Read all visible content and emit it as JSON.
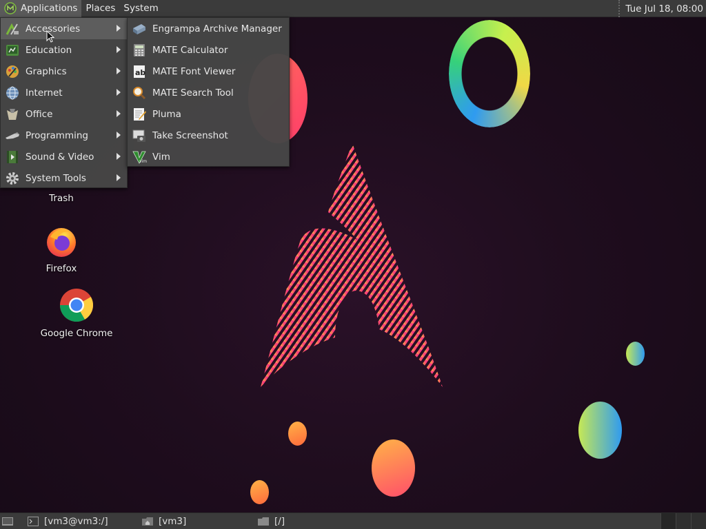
{
  "top_panel": {
    "menus": [
      "Applications",
      "Places",
      "System"
    ],
    "clock": "Tue Jul 18, 08:00"
  },
  "app_menu": {
    "items": [
      {
        "label": "Accessories",
        "icon": "accessories-icon"
      },
      {
        "label": "Education",
        "icon": "education-icon"
      },
      {
        "label": "Graphics",
        "icon": "graphics-icon"
      },
      {
        "label": "Internet",
        "icon": "internet-icon"
      },
      {
        "label": "Office",
        "icon": "office-icon"
      },
      {
        "label": "Programming",
        "icon": "programming-icon"
      },
      {
        "label": "Sound & Video",
        "icon": "sound-video-icon"
      },
      {
        "label": "System Tools",
        "icon": "system-tools-icon"
      }
    ]
  },
  "accessories_menu": {
    "items": [
      {
        "label": "Engrampa Archive Manager",
        "icon": "archive-manager-icon"
      },
      {
        "label": "MATE Calculator",
        "icon": "calculator-icon"
      },
      {
        "label": "MATE Font Viewer",
        "icon": "font-viewer-icon"
      },
      {
        "label": "MATE Search Tool",
        "icon": "search-tool-icon"
      },
      {
        "label": "Pluma",
        "icon": "text-editor-icon"
      },
      {
        "label": "Take Screenshot",
        "icon": "screenshot-icon"
      },
      {
        "label": "Vim",
        "icon": "vim-icon"
      }
    ]
  },
  "desktop": {
    "icons": [
      {
        "label": "Trash",
        "icon": "trash-icon"
      },
      {
        "label": "Firefox",
        "icon": "firefox-icon"
      },
      {
        "label": "Google Chrome",
        "icon": "chrome-icon"
      }
    ]
  },
  "bottom_panel": {
    "tasks": [
      {
        "label": "[vm3@vm3:/]",
        "icon": "terminal-icon"
      },
      {
        "label": "[vm3]",
        "icon": "home-folder-icon"
      },
      {
        "label": "[/]",
        "icon": "folder-icon"
      }
    ]
  }
}
